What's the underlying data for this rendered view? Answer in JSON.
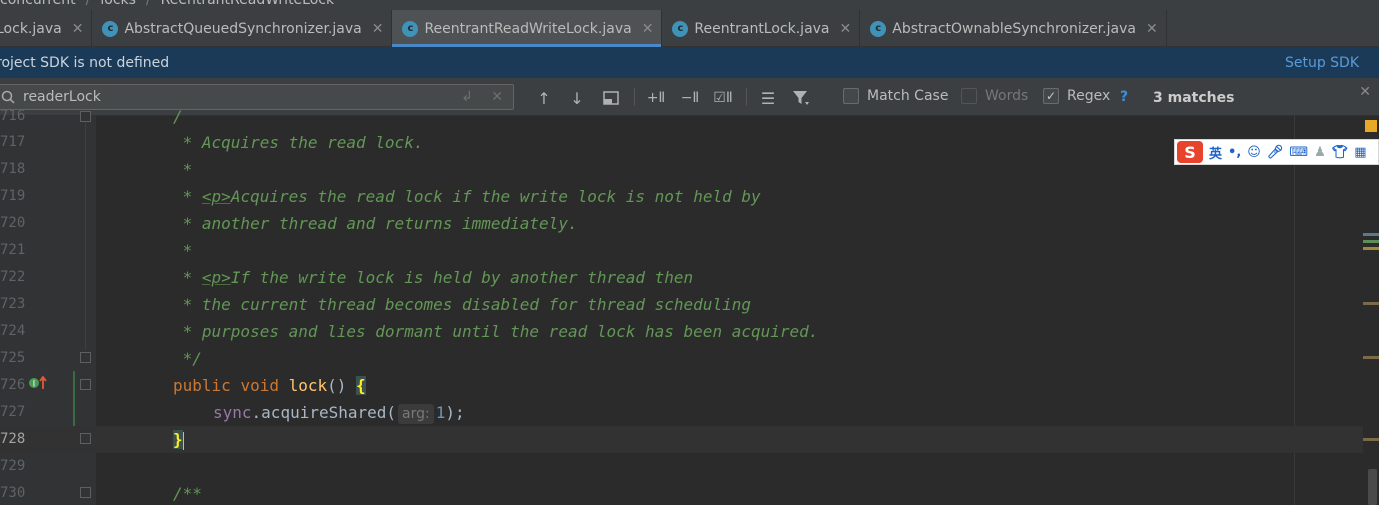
{
  "breadcrumb": {
    "items": [
      "concurrent",
      "locks",
      "ReentrantReadWriteLock"
    ]
  },
  "tabs": [
    {
      "label": "Lock.java",
      "active": false
    },
    {
      "label": "AbstractQueuedSynchronizer.java",
      "active": false
    },
    {
      "label": "ReentrantReadWriteLock.java",
      "active": true
    },
    {
      "label": "ReentrantLock.java",
      "active": false
    },
    {
      "label": "AbstractOwnableSynchronizer.java",
      "active": false
    }
  ],
  "tab_icon_letter": "c",
  "sdk_banner": {
    "message": "roject SDK is not defined",
    "action": "Setup SDK"
  },
  "search": {
    "query": "readerLock",
    "match_case_label": "Match Case",
    "match_case_checked": false,
    "words_label": "Words",
    "words_checked": false,
    "regex_label": "Regex",
    "regex_checked": true,
    "help": "?",
    "matches": "3 matches"
  },
  "ime": {
    "logo": "S",
    "lang": "英",
    "punct": "•,"
  },
  "editor": {
    "lines": [
      {
        "num": "716",
        "text": "/"
      },
      {
        "num": "717",
        "text": " * Acquires the read lock."
      },
      {
        "num": "718",
        "text": " *"
      },
      {
        "num": "719",
        "pre": " * ",
        "tag": "<p>",
        "rest": "Acquires the read lock if the write lock is not held by"
      },
      {
        "num": "720",
        "text": " * another thread and returns immediately."
      },
      {
        "num": "721",
        "text": " *"
      },
      {
        "num": "722",
        "pre": " * ",
        "tag": "<p>",
        "rest": "If the write lock is held by another thread then"
      },
      {
        "num": "723",
        "text": " * the current thread becomes disabled for thread scheduling"
      },
      {
        "num": "724",
        "text": " * purposes and lies dormant until the read lock has been acquired."
      },
      {
        "num": "725",
        "text": " */"
      },
      {
        "num": "726",
        "kw1": "public",
        "kw2": "void",
        "meth": "lock",
        "paren": "() ",
        "brace": "{"
      },
      {
        "num": "727",
        "field": "sync",
        "dot": ".",
        "meth": "acquireShared",
        "open": "(",
        "hint": "arg:",
        "num_val": "1",
        "close": ");"
      },
      {
        "num": "728",
        "brace": "}"
      },
      {
        "num": "729",
        "text": ""
      },
      {
        "num": "730",
        "text": "/**"
      }
    ]
  },
  "colors": {
    "accent": "#4a88c7",
    "banner": "#1b3a58",
    "doc_comment": "#629755",
    "keyword": "#cc7832",
    "method": "#ffc66d"
  }
}
